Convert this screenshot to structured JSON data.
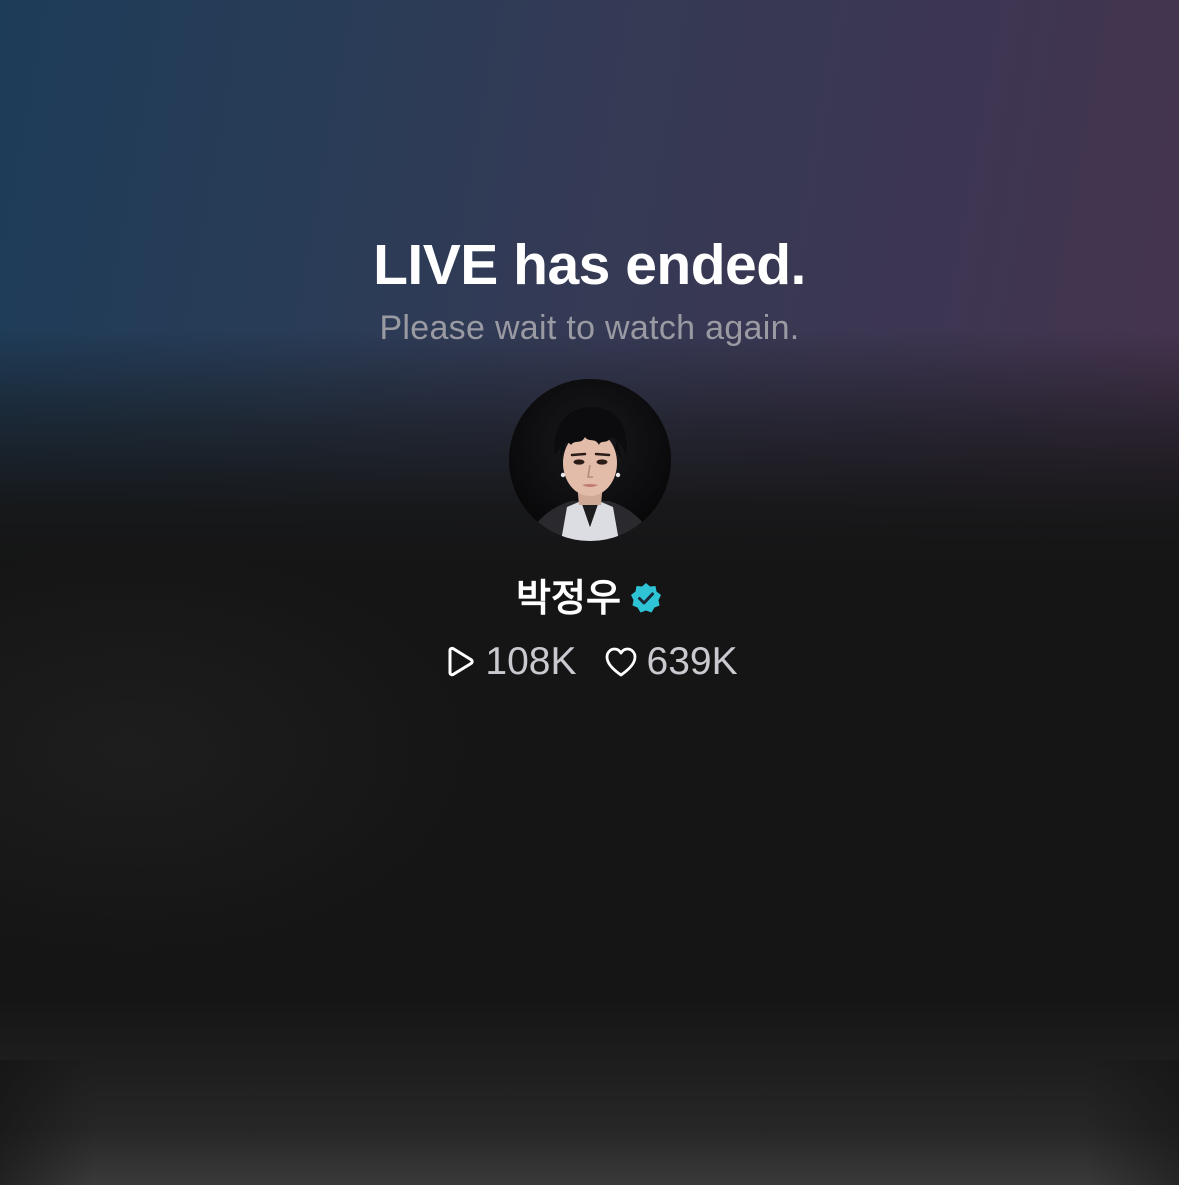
{
  "live_status": {
    "title": "LIVE has ended.",
    "subtitle": "Please wait to watch again."
  },
  "profile": {
    "name": "박정우",
    "verified": true,
    "avatar_icon": "profile-photo",
    "verified_badge_color": "#2ec4d6"
  },
  "stats": {
    "plays": {
      "icon": "play-icon",
      "value": "108K"
    },
    "likes": {
      "icon": "heart-icon",
      "value": "639K"
    }
  }
}
